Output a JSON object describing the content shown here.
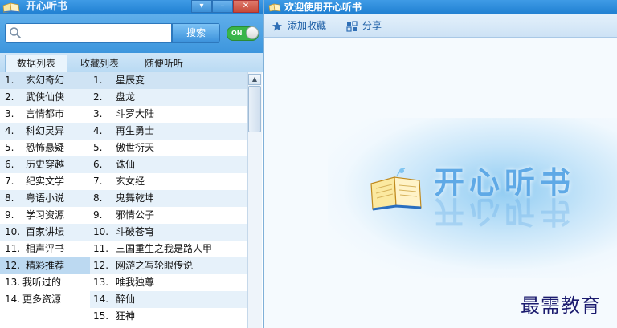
{
  "left_window": {
    "title": "开心听书",
    "controls": [
      "▾",
      "–",
      "✕"
    ]
  },
  "search": {
    "value": "",
    "button_label": "搜索",
    "toggle_label": "ON"
  },
  "tabs": [
    {
      "label": "数据列表",
      "active": true
    },
    {
      "label": "收藏列表",
      "active": false
    },
    {
      "label": "随便听听",
      "active": false
    }
  ],
  "categories": [
    {
      "num": "1.",
      "label": "玄幻奇幻"
    },
    {
      "num": "2.",
      "label": "武侠仙侠"
    },
    {
      "num": "3.",
      "label": "言情都市"
    },
    {
      "num": "4.",
      "label": "科幻灵异"
    },
    {
      "num": "5.",
      "label": "恐怖悬疑"
    },
    {
      "num": "6.",
      "label": "历史穿越"
    },
    {
      "num": "7.",
      "label": "纪实文学"
    },
    {
      "num": "8.",
      "label": "粤语小说"
    },
    {
      "num": "9.",
      "label": "学习资源"
    },
    {
      "num": "10.",
      "label": "百家讲坛"
    },
    {
      "num": "11.",
      "label": "相声评书"
    },
    {
      "num": "12.",
      "label": "精彩推荐"
    },
    {
      "num": "13.",
      "label": "我听过的"
    },
    {
      "num": "14.",
      "label": "更多资源"
    }
  ],
  "books": [
    {
      "num": "1.",
      "label": "星辰变"
    },
    {
      "num": "2.",
      "label": "盘龙"
    },
    {
      "num": "3.",
      "label": "斗罗大陆"
    },
    {
      "num": "4.",
      "label": "再生勇士"
    },
    {
      "num": "5.",
      "label": "傲世衍天"
    },
    {
      "num": "6.",
      "label": "诛仙"
    },
    {
      "num": "7.",
      "label": "玄女经"
    },
    {
      "num": "8.",
      "label": "鬼舞乾坤"
    },
    {
      "num": "9.",
      "label": "邪情公子"
    },
    {
      "num": "10.",
      "label": "斗破苍穹"
    },
    {
      "num": "11.",
      "label": "三国重生之我是路人甲"
    },
    {
      "num": "12.",
      "label": "网游之写轮眼传说"
    },
    {
      "num": "13.",
      "label": "唯我独尊"
    },
    {
      "num": "14.",
      "label": "醉仙"
    },
    {
      "num": "15.",
      "label": "狂神"
    }
  ],
  "right_window": {
    "title": "欢迎使用开心听书",
    "toolbar": {
      "favorite_label": "添加收藏",
      "share_label": "分享"
    },
    "brand": "开心听书",
    "watermark": "最需教育"
  },
  "colors": {
    "titlebar": "#1f7fd1",
    "accent": "#3d96dd",
    "toggle_on": "#39b54a",
    "selected_row": "#cfe3f4"
  }
}
